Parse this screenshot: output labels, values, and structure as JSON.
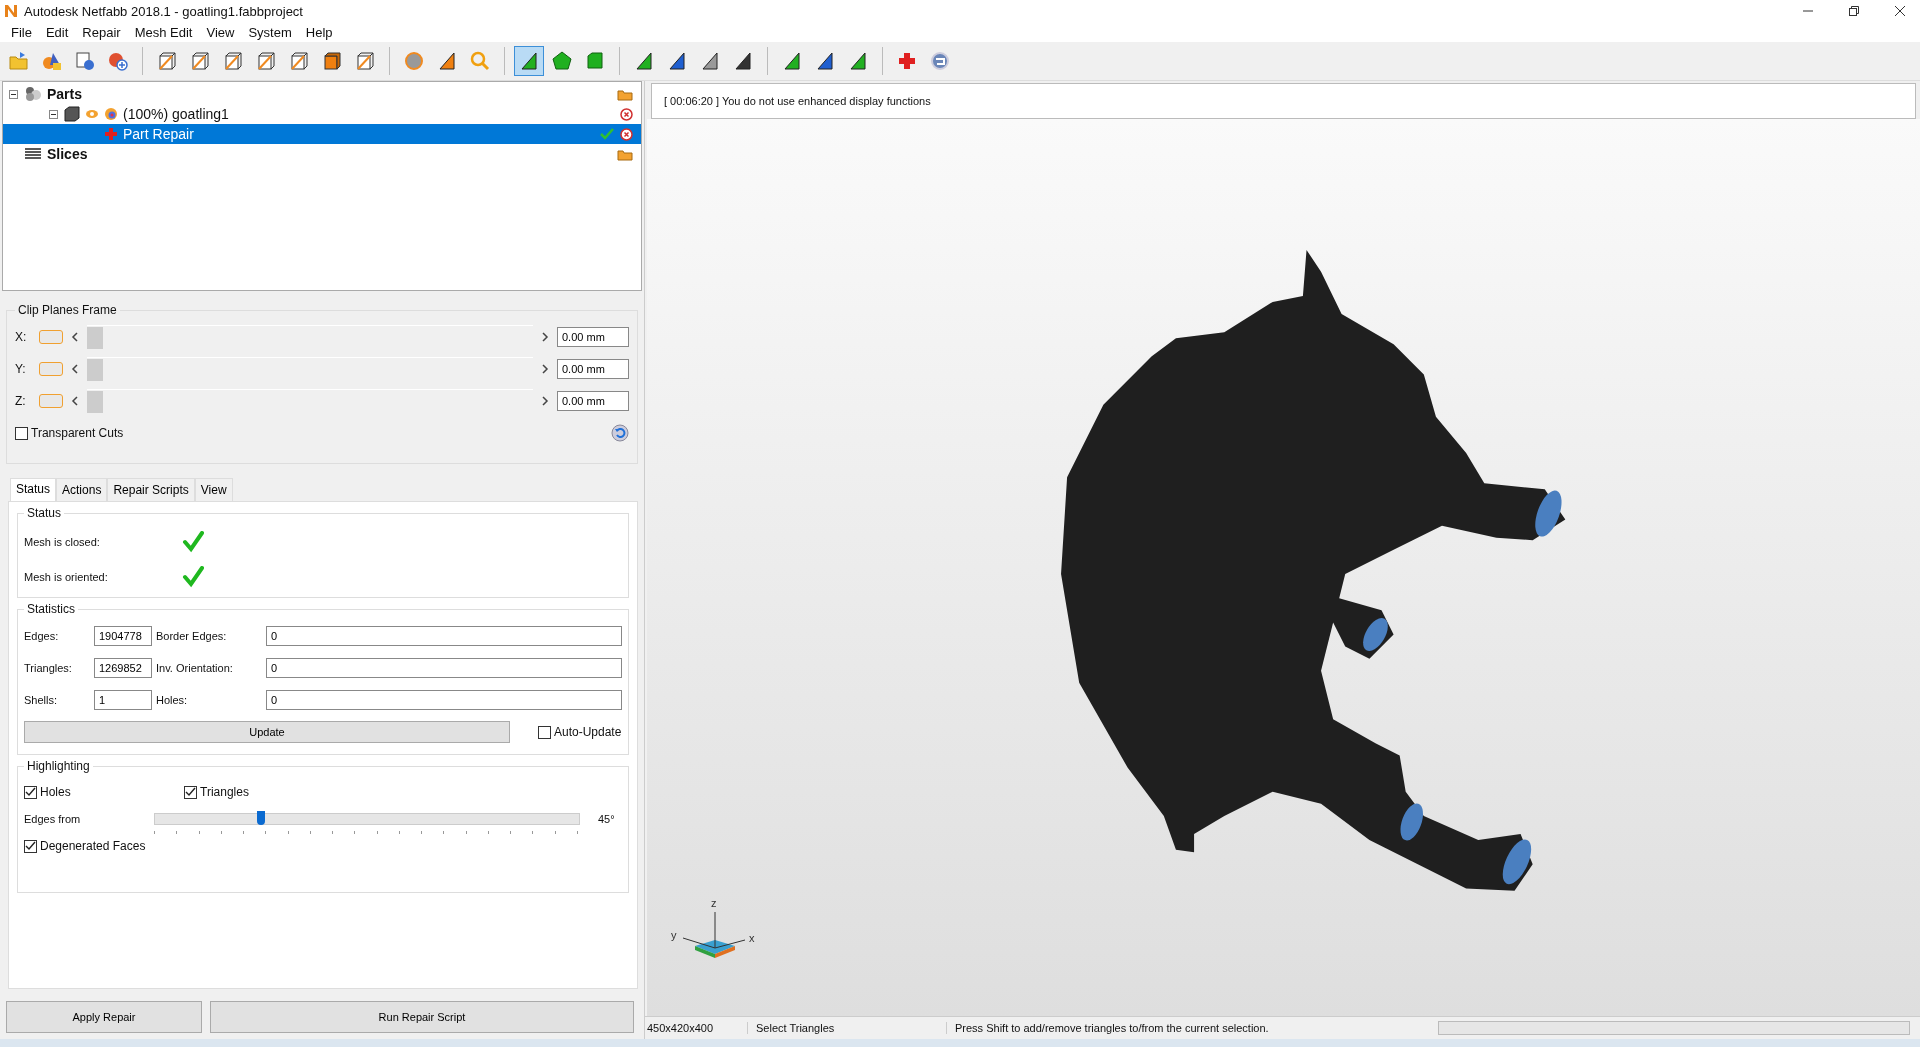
{
  "window": {
    "title": "Autodesk Netfabb 2018.1 - goatling1.fabbproject"
  },
  "menu": [
    "File",
    "Edit",
    "Repair",
    "Mesh Edit",
    "View",
    "System",
    "Help"
  ],
  "toolbar": [
    [
      {
        "kind": "open",
        "selected": false
      },
      {
        "kind": "shapes",
        "selected": false
      },
      {
        "kind": "info",
        "selected": false
      },
      {
        "kind": "add",
        "selected": false
      }
    ],
    [
      {
        "kind": "cube",
        "selected": false
      },
      {
        "kind": "cube",
        "selected": false
      },
      {
        "kind": "cube",
        "selected": false
      },
      {
        "kind": "cube",
        "selected": false
      },
      {
        "kind": "cube",
        "selected": false
      },
      {
        "kind": "cubefill",
        "selected": false
      },
      {
        "kind": "cube",
        "selected": false
      }
    ],
    [
      {
        "kind": "sphere",
        "selected": false
      },
      {
        "kind": "tri-orange",
        "selected": false
      },
      {
        "kind": "zoom",
        "selected": false
      }
    ],
    [
      {
        "kind": "tri-green",
        "selected": true
      },
      {
        "kind": "pentagon",
        "selected": false
      },
      {
        "kind": "square-green",
        "selected": false
      }
    ],
    [
      {
        "kind": "tri-green",
        "selected": false
      },
      {
        "kind": "tri-blue",
        "selected": false
      },
      {
        "kind": "tri-grey",
        "selected": false
      },
      {
        "kind": "tri-dark",
        "selected": false
      }
    ],
    [
      {
        "kind": "tri-green",
        "selected": false
      },
      {
        "kind": "tri-blue",
        "selected": false
      },
      {
        "kind": "tri-green",
        "selected": false
      }
    ],
    [
      {
        "kind": "cross",
        "selected": false
      },
      {
        "kind": "globe",
        "selected": false
      }
    ]
  ],
  "tree": [
    {
      "label": "Parts",
      "kind": "group",
      "expanded": true,
      "selected": false,
      "children": [
        {
          "label": "(100%) goatling1",
          "kind": "part",
          "expanded": true,
          "selected": false,
          "children": [
            {
              "label": "Part Repair",
              "kind": "repair",
              "selected": true
            }
          ]
        }
      ]
    },
    {
      "label": "Slices",
      "kind": "group",
      "selected": false
    }
  ],
  "clip_planes": {
    "title": "Clip Planes Frame",
    "axes": [
      {
        "label": "X:",
        "active": false,
        "level": 0,
        "value": "0.00 mm"
      },
      {
        "label": "Y:",
        "active": false,
        "level": 0,
        "value": "0.00 mm"
      },
      {
        "label": "Z:",
        "active": false,
        "level": 0,
        "value": "0.00 mm"
      }
    ],
    "transparent_cuts": {
      "label": "Transparent Cuts",
      "checked": false
    }
  },
  "tabs": [
    {
      "label": "Status",
      "selected": true
    },
    {
      "label": "Actions",
      "selected": false
    },
    {
      "label": "Repair Scripts",
      "selected": false
    },
    {
      "label": "View",
      "selected": false
    }
  ],
  "status": {
    "title": "Status",
    "items": [
      {
        "label": "Mesh is closed:",
        "checked": true
      },
      {
        "label": "Mesh is oriented:",
        "checked": true
      }
    ]
  },
  "statistics": {
    "title": "Statistics",
    "rows": [
      {
        "label": "Edges:",
        "value": "1904778",
        "label2": "Border Edges:",
        "value2": "0"
      },
      {
        "label": "Triangles:",
        "value": "1269852",
        "label2": "Inv. Orientation:",
        "value2": "0"
      },
      {
        "label": "Shells:",
        "value": "1",
        "label2": "Holes:",
        "value2": "0"
      }
    ],
    "update_button": "Update",
    "auto_update": {
      "label": "Auto-Update",
      "checked": false
    }
  },
  "highlighting": {
    "title": "Highlighting",
    "holes": {
      "label": "Holes",
      "checked": true
    },
    "triangles": {
      "label": "Triangles",
      "checked": true
    },
    "edges_from": {
      "label": "Edges from",
      "level": 0.25,
      "reading": "45°"
    },
    "degenerated": {
      "label": "Degenerated Faces",
      "checked": true
    }
  },
  "buttons": [
    "Apply Repair",
    "Run Repair Script"
  ],
  "axes_gizmo": [
    {
      "kind": "z",
      "label": "z"
    },
    {
      "kind": "y",
      "label": "y"
    },
    {
      "kind": "x",
      "label": "x"
    }
  ],
  "log": "[ 00:06:20 ] You do not use enhanced display functions",
  "status_bar": {
    "dimensions": "450x420x400",
    "mode": "Select Triangles",
    "hint": "Press Shift to add/remove triangles to/from the current selection.",
    "progress": {
      "level": 0
    }
  }
}
